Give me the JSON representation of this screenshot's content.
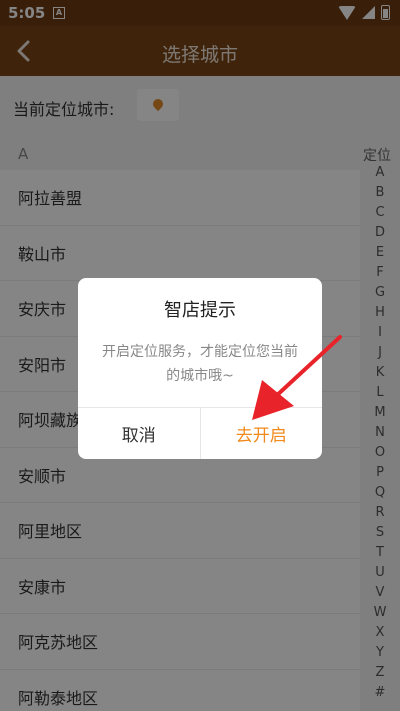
{
  "status_bar": {
    "time": "5:05",
    "notification": "A"
  },
  "header": {
    "title": "选择城市"
  },
  "location": {
    "label": "当前定位城市:"
  },
  "section": {
    "letter": "A"
  },
  "index": {
    "title": "定位",
    "letters": [
      "A",
      "B",
      "C",
      "D",
      "E",
      "F",
      "G",
      "H",
      "I",
      "J",
      "K",
      "L",
      "M",
      "N",
      "O",
      "P",
      "Q",
      "R",
      "S",
      "T",
      "U",
      "V",
      "W",
      "X",
      "Y",
      "Z",
      "#"
    ]
  },
  "cities": [
    "阿拉善盟",
    "鞍山市",
    "安庆市",
    "安阳市",
    "阿坝藏族",
    "安顺市",
    "阿里地区",
    "安康市",
    "阿克苏地区",
    "阿勒泰地区"
  ],
  "dialog": {
    "title": "智店提示",
    "message": "开启定位服务，才能定位您当前的城市哦~",
    "cancel_label": "取消",
    "confirm_label": "去开启"
  },
  "colors": {
    "header": "#7a4516",
    "accent": "#ef8a1b",
    "arrow": "#e8232a"
  }
}
